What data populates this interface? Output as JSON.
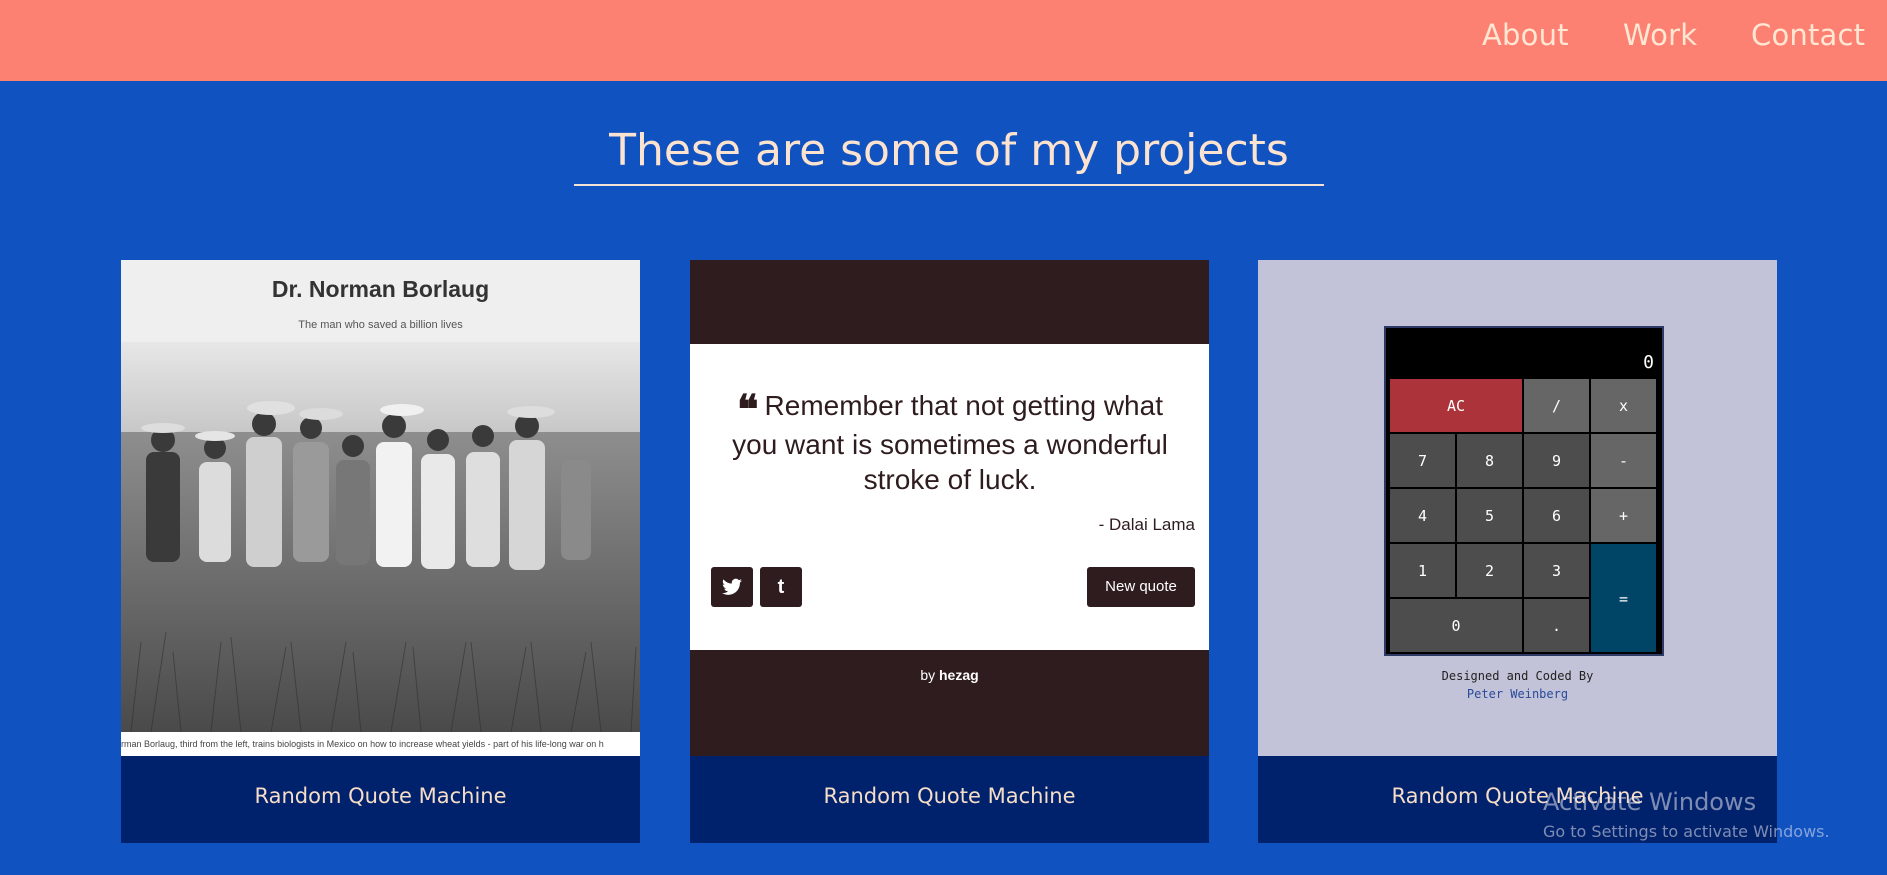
{
  "nav": {
    "items": [
      "About",
      "Work",
      "Contact"
    ]
  },
  "heading": "These are some of my projects",
  "cards": [
    {
      "caption": "Random Quote Machine",
      "preview": {
        "title": "Dr. Norman Borlaug",
        "subtitle": "The man who saved a billion lives",
        "photo_caption": "rman Borlaug, third from the left, trains biologists in Mexico on how to increase wheat yields - part of his life-long war on h"
      }
    },
    {
      "caption": "Random Quote Machine",
      "preview": {
        "quote_mark": "❝",
        "quote": "Remember that not getting what you want is sometimes a wonderful stroke of luck.",
        "author": "- Dalai Lama",
        "twitter": "t",
        "tumblr": "t",
        "button": "New quote",
        "by_prefix": "by ",
        "by_name": "hezag"
      }
    },
    {
      "caption": "Random Quote Machine",
      "preview": {
        "display": "0",
        "keys": [
          "AC",
          "/",
          "x",
          "7",
          "8",
          "9",
          "-",
          "4",
          "5",
          "6",
          "+",
          "1",
          "2",
          "3",
          "=",
          "0",
          "."
        ],
        "credit_line": "Designed and Coded By",
        "credit_name": "Peter Weinberg"
      }
    }
  ],
  "watermark": {
    "line1": "Activate Windows",
    "line2": "Go to Settings to activate Windows."
  },
  "colors": {
    "nav_bg": "#fd8172",
    "page_bg": "#1052c0",
    "caption_bg": "#00216b",
    "calc_ac": "#ac3339",
    "calc_equals": "#004466"
  }
}
